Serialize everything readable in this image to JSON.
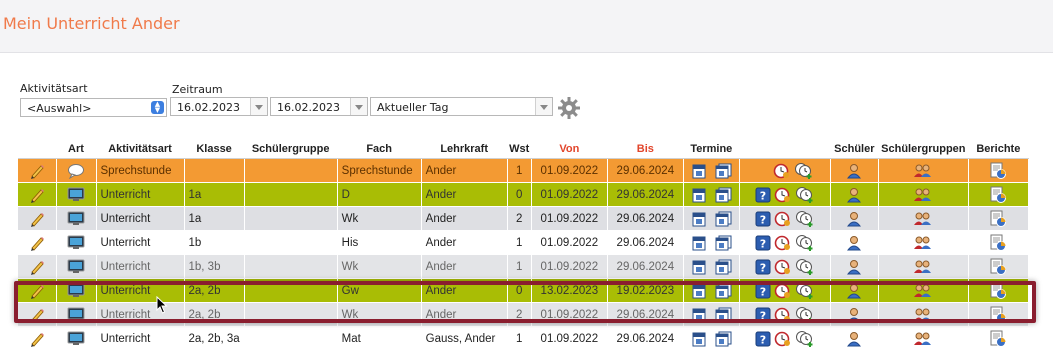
{
  "page": {
    "title": "Mein Unterricht Ander"
  },
  "filters": {
    "aktivitaetsart_label": "Aktivitätsart",
    "aktivitaetsart_value": "<Auswahl>",
    "zeitraum_label": "Zeitraum",
    "date_from": "16.02.2023",
    "date_to": "16.02.2023",
    "period_value": "Aktueller Tag"
  },
  "table": {
    "headers": {
      "art": "Art",
      "aktivitaetsart": "Aktivitätsart",
      "klasse": "Klasse",
      "schuelergruppe": "Schülergruppe",
      "fach": "Fach",
      "lehrkraft": "Lehrkraft",
      "wst": "Wst",
      "von": "Von",
      "bis": "Bis",
      "termine": "Termine",
      "schueler": "Schüler",
      "schuelergruppen": "Schülergruppen",
      "berichte": "Berichte"
    },
    "rows": [
      {
        "aktivitaetsart": "Sprechstunde",
        "klasse": "",
        "schuelergruppe": "",
        "fach": "Sprechstunde",
        "lehrkraft": "Ander",
        "wst": "1",
        "von": "01.09.2022",
        "bis": "29.06.2024"
      },
      {
        "aktivitaetsart": "Unterricht",
        "klasse": "1a",
        "schuelergruppe": "",
        "fach": "D",
        "lehrkraft": "Ander",
        "wst": "0",
        "von": "01.09.2022",
        "bis": "29.06.2024"
      },
      {
        "aktivitaetsart": "Unterricht",
        "klasse": "1a",
        "schuelergruppe": "",
        "fach": "Wk",
        "lehrkraft": "Ander",
        "wst": "2",
        "von": "01.09.2022",
        "bis": "29.06.2024"
      },
      {
        "aktivitaetsart": "Unterricht",
        "klasse": "1b",
        "schuelergruppe": "",
        "fach": "His",
        "lehrkraft": "Ander",
        "wst": "1",
        "von": "01.09.2022",
        "bis": "29.06.2024"
      },
      {
        "aktivitaetsart": "Unterricht",
        "klasse": "1b, 3b",
        "schuelergruppe": "",
        "fach": "Wk",
        "lehrkraft": "Ander",
        "wst": "1",
        "von": "01.09.2022",
        "bis": "29.06.2024"
      },
      {
        "aktivitaetsart": "Unterricht",
        "klasse": "2a, 2b",
        "schuelergruppe": "",
        "fach": "Gw",
        "lehrkraft": "Ander",
        "wst": "0",
        "von": "13.02.2023",
        "bis": "19.02.2023"
      },
      {
        "aktivitaetsart": "Unterricht",
        "klasse": "2a, 2b",
        "schuelergruppe": "",
        "fach": "Wk",
        "lehrkraft": "Ander",
        "wst": "2",
        "von": "01.09.2022",
        "bis": "29.06.2024"
      },
      {
        "aktivitaetsart": "Unterricht",
        "klasse": "2a, 2b, 3a",
        "schuelergruppe": "",
        "fach": "Mat",
        "lehrkraft": "Gauss, Ander",
        "wst": "1",
        "von": "01.09.2022",
        "bis": "29.06.2024"
      }
    ]
  },
  "colors": {
    "title": "#f07a4a",
    "orange_row": "#f39a33",
    "green_row": "#a9bd05",
    "grey_row": "#dedfe3",
    "highlight_border": "#8a1e2f",
    "red_header": "#e2452b"
  },
  "icons": [
    "pencil-icon",
    "speech-bubble-icon",
    "monitor-icon",
    "calendar-icon",
    "calendar-multi-icon",
    "help-icon",
    "clock-icon",
    "clock-add-icon",
    "student-icon",
    "student-group-icon",
    "report-icon",
    "gear-icon",
    "mouse-cursor-icon"
  ]
}
